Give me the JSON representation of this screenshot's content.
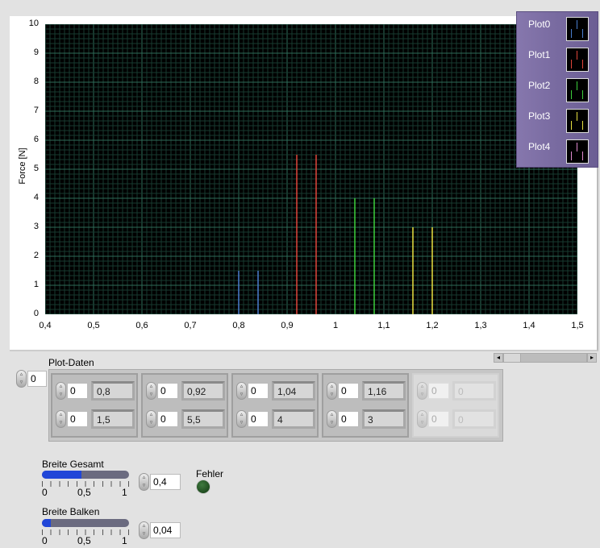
{
  "chart_data": {
    "type": "bar",
    "ylabel": "Force [N]",
    "xlabel": "",
    "xlim": [
      0.4,
      1.5
    ],
    "ylim": [
      0,
      10
    ],
    "xticks": [
      "0,4",
      "0,5",
      "0,6",
      "0,7",
      "0,8",
      "0,9",
      "1",
      "1,1",
      "1,2",
      "1,3",
      "1,4",
      "1,5"
    ],
    "yticks": [
      "0",
      "1",
      "2",
      "3",
      "4",
      "5",
      "6",
      "7",
      "8",
      "9",
      "10"
    ],
    "grid": true,
    "series": [
      {
        "name": "Plot0",
        "color": "#4a7fd0",
        "x": [
          0.8,
          0.84
        ],
        "values": [
          1.5,
          1.5
        ]
      },
      {
        "name": "Plot1",
        "color": "#e0453a",
        "x": [
          0.92,
          0.96
        ],
        "values": [
          5.5,
          5.5
        ]
      },
      {
        "name": "Plot2",
        "color": "#3ccf3c",
        "x": [
          1.04,
          1.08
        ],
        "values": [
          4,
          4
        ]
      },
      {
        "name": "Plot3",
        "color": "#e8e040",
        "x": [
          1.16,
          1.2
        ],
        "values": [
          3,
          3
        ]
      },
      {
        "name": "Plot4",
        "color": "#e08ad0",
        "x": [],
        "values": []
      }
    ],
    "legend_position": "top-right"
  },
  "array": {
    "label": "Plot-Daten",
    "index": "0",
    "cells": [
      {
        "i1": "0",
        "v1": "0,8",
        "i2": "0",
        "v2": "1,5"
      },
      {
        "i1": "0",
        "v1": "0,92",
        "i2": "0",
        "v2": "5,5"
      },
      {
        "i1": "0",
        "v1": "1,04",
        "i2": "0",
        "v2": "4"
      },
      {
        "i1": "0",
        "v1": "1,16",
        "i2": "0",
        "v2": "3"
      },
      {
        "i1": "0",
        "v1": "0",
        "i2": "0",
        "v2": "0"
      }
    ]
  },
  "breite_gesamt": {
    "label": "Breite Gesamt",
    "value": "0,4",
    "fraction": 0.4,
    "scale": [
      "0",
      "0,5",
      "1"
    ]
  },
  "breite_balken": {
    "label": "Breite Balken",
    "value": "0,04",
    "fraction": 0.04,
    "scale": [
      "0",
      "0,5",
      "1"
    ]
  },
  "fehler": {
    "label": "Fehler",
    "color": "#1f5a1f"
  }
}
